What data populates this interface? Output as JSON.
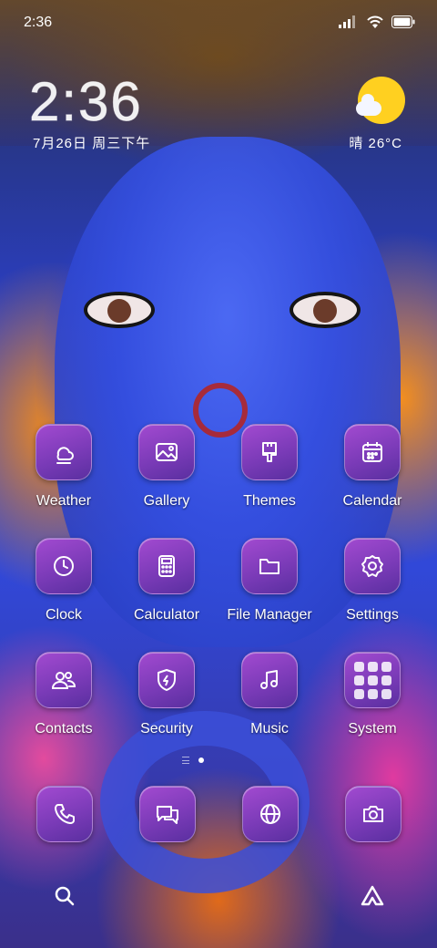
{
  "status_bar": {
    "time": "2:36"
  },
  "clock_widget": {
    "time": "2:36",
    "date": "7月26日 周三下午",
    "weather": "晴 26°C"
  },
  "apps": [
    {
      "label": "Weather",
      "icon": "weather-icon"
    },
    {
      "label": "Gallery",
      "icon": "gallery-icon"
    },
    {
      "label": "Themes",
      "icon": "themes-icon"
    },
    {
      "label": "Calendar",
      "icon": "calendar-icon"
    },
    {
      "label": "Clock",
      "icon": "clock-icon"
    },
    {
      "label": "Calculator",
      "icon": "calculator-icon"
    },
    {
      "label": "File Manager",
      "icon": "folder-icon"
    },
    {
      "label": "Settings",
      "icon": "gear-icon"
    },
    {
      "label": "Contacts",
      "icon": "contacts-icon"
    },
    {
      "label": "Security",
      "icon": "shield-icon"
    },
    {
      "label": "Music",
      "icon": "music-icon"
    },
    {
      "label": "System",
      "icon": "folder-grid-icon"
    }
  ],
  "dock": [
    "phone-icon",
    "messages-icon",
    "browser-icon",
    "camera-icon"
  ],
  "bottom": [
    "search-icon",
    "app-drawer-icon"
  ],
  "page_indicator": {
    "pages": 2,
    "current": 1
  },
  "colors": {
    "icon_gradient_top": "#a24ad0",
    "icon_gradient_bottom": "#5a2fa0",
    "sun": "#ffd020"
  }
}
